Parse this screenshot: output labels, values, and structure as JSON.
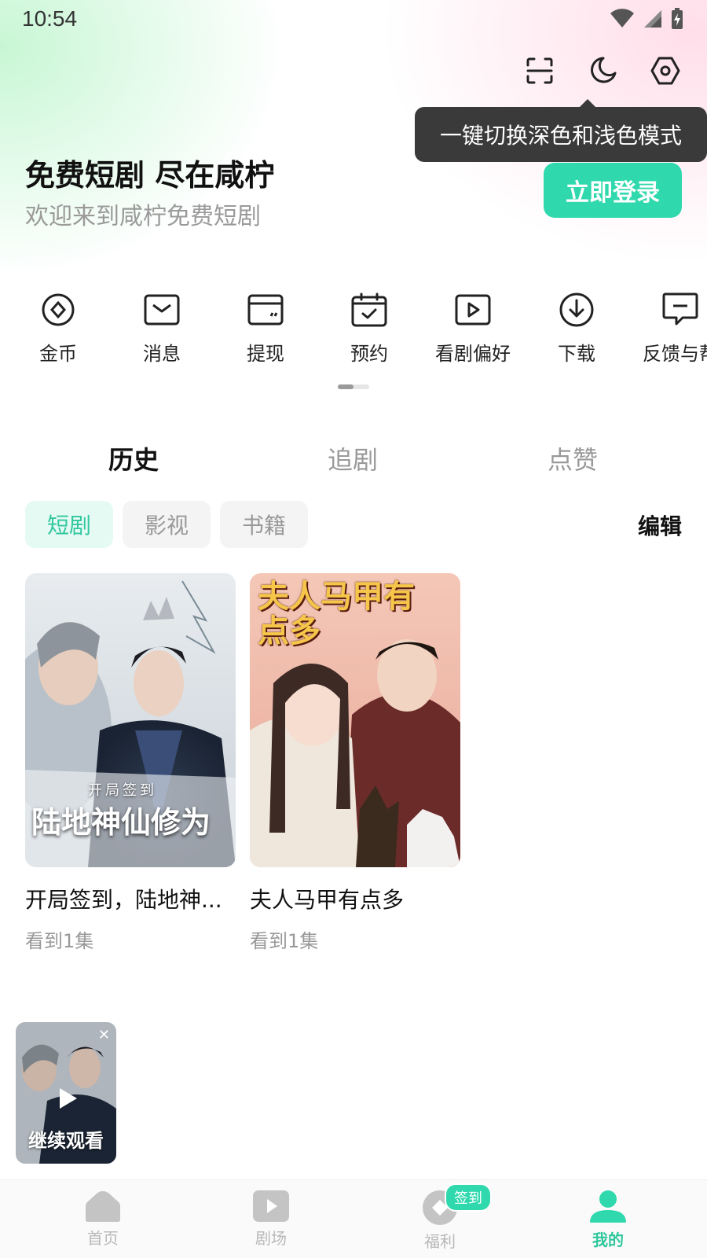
{
  "status_bar": {
    "time": "10:54"
  },
  "tooltip": {
    "text": "一键切换深色和浅色模式"
  },
  "hero": {
    "title": "免费短剧 尽在咸柠",
    "subtitle": "欢迎来到咸柠免费短剧",
    "login_label": "立即登录"
  },
  "quick_actions": [
    {
      "label": "金币",
      "icon": "coin-icon"
    },
    {
      "label": "消息",
      "icon": "message-icon"
    },
    {
      "label": "提现",
      "icon": "wallet-icon"
    },
    {
      "label": "预约",
      "icon": "calendar-icon"
    },
    {
      "label": "看剧偏好",
      "icon": "play-preference-icon"
    },
    {
      "label": "下载",
      "icon": "download-icon"
    },
    {
      "label": "反馈与帮",
      "icon": "feedback-icon"
    }
  ],
  "tabs": [
    {
      "label": "历史",
      "active": true
    },
    {
      "label": "追剧",
      "active": false
    },
    {
      "label": "点赞",
      "active": false
    }
  ],
  "chips": [
    {
      "label": "短剧",
      "active": true
    },
    {
      "label": "影视",
      "active": false
    },
    {
      "label": "书籍",
      "active": false
    }
  ],
  "edit_label": "编辑",
  "history": [
    {
      "title": "开局签到，陆地神...",
      "progress": "看到1集",
      "poster_text": "陆地神仙修为",
      "poster_sub": "开局签到"
    },
    {
      "title": "夫人马甲有点多",
      "progress": "看到1集",
      "poster_text": "夫人马甲有点多"
    }
  ],
  "mini_player": {
    "label": "继续观看"
  },
  "bottom_nav": [
    {
      "label": "首页",
      "icon": "home-icon",
      "active": false
    },
    {
      "label": "剧场",
      "icon": "theater-icon",
      "active": false
    },
    {
      "label": "福利",
      "icon": "welfare-icon",
      "active": false,
      "badge": "签到"
    },
    {
      "label": "我的",
      "icon": "profile-icon",
      "active": true
    }
  ],
  "colors": {
    "accent": "#2fd9ad",
    "accent_text": "#2fc79c",
    "tooltip_bg": "#3a3a3a"
  }
}
